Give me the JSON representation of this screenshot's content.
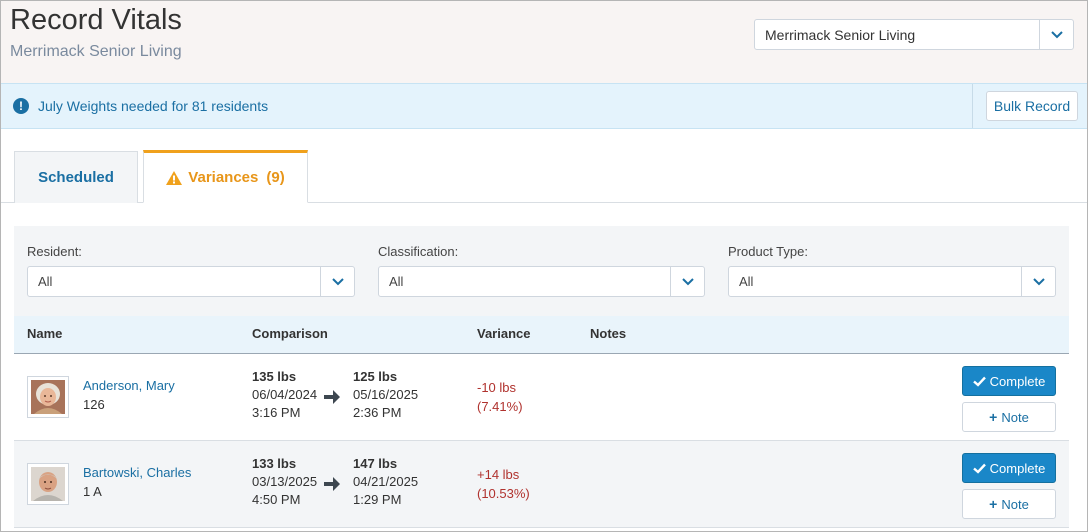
{
  "header": {
    "title": "Record Vitals",
    "subtitle": "Merrimack Senior Living",
    "facility_select": {
      "value": "Merrimack Senior Living"
    }
  },
  "alert": {
    "icon": "exclamation-circle-icon",
    "text": "July Weights needed for 81 residents",
    "bulk_button": "Bulk Record"
  },
  "tabs": [
    {
      "label": "Scheduled",
      "active": false
    },
    {
      "label": "Variances",
      "count": "(9)",
      "active": true,
      "icon": "warning-triangle-icon"
    }
  ],
  "filters": [
    {
      "label": "Resident:",
      "value": "All"
    },
    {
      "label": "Classification:",
      "value": "All"
    },
    {
      "label": "Product Type:",
      "value": "All"
    }
  ],
  "table": {
    "columns": [
      "Name",
      "Comparison",
      "Variance",
      "Notes"
    ],
    "rows": [
      {
        "name": "Anderson, Mary",
        "room": "126",
        "from": {
          "weight": "135 lbs",
          "date": "06/04/2024",
          "time": "3:16 PM"
        },
        "to": {
          "weight": "125 lbs",
          "date": "05/16/2025",
          "time": "2:36 PM"
        },
        "variance": "-10 lbs",
        "variance_pct": "(7.41%)",
        "complete_label": "Complete",
        "note_label": "Note"
      },
      {
        "name": "Bartowski, Charles",
        "room": "1 A",
        "from": {
          "weight": "133 lbs",
          "date": "03/13/2025",
          "time": "4:50 PM"
        },
        "to": {
          "weight": "147 lbs",
          "date": "04/21/2025",
          "time": "1:29 PM"
        },
        "variance": "+14 lbs",
        "variance_pct": "(10.53%)",
        "complete_label": "Complete",
        "note_label": "Note"
      }
    ]
  },
  "colors": {
    "accent": "#1a6fa3",
    "primary_button": "#1a87c8",
    "warning": "#f0a11c",
    "variance": "#b0322e"
  }
}
